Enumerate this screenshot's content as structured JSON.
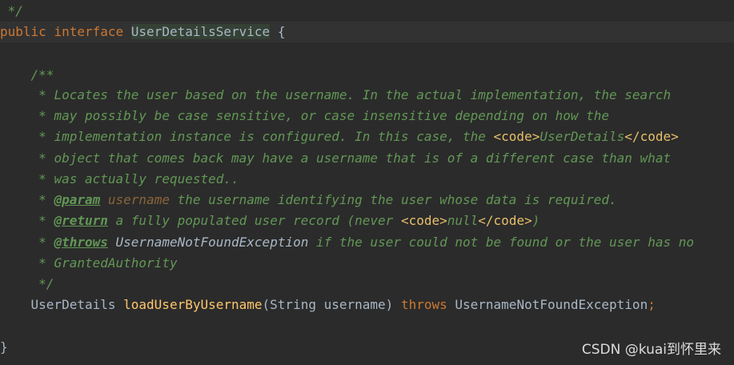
{
  "editor": {
    "lines": {
      "l0": {
        "close": " */"
      },
      "l1": {
        "kw_public": "public",
        "kw_interface": "interface",
        "name": "UserDetailsService",
        "brace": "{"
      },
      "l2": {
        "open": "/**"
      },
      "l3": {
        "text": "Locates the user based on the username. In the actual implementation, the search"
      },
      "l4": {
        "text": "may possibly be case sensitive, or case insensitive depending on how the"
      },
      "l5": {
        "text": "implementation instance is configured. In this case, the ",
        "code_open": "<code>",
        "code_text": "UserDetails",
        "code_close": "</code>"
      },
      "l6": {
        "text": "object that comes back may have a username that is of a different case than what"
      },
      "l7": {
        "text": "was actually requested.."
      },
      "l8": {
        "tag": "@param",
        "param": "username",
        "text": "the username identifying the user whose data is required."
      },
      "l9": {
        "tag": "@return",
        "text": "a fully populated user record (never ",
        "code_open": "<code>",
        "code_text": "null",
        "code_close": "</code>",
        "tail": ")"
      },
      "l10": {
        "tag": "@throws",
        "type": "UsernameNotFoundException",
        "text": "if the user could not be found or the user has no"
      },
      "l11": {
        "text": "GrantedAuthority"
      },
      "l12": {
        "close": "*/"
      },
      "l13": {
        "ret_type": "UserDetails",
        "method": "loadUserByUsername",
        "params": "(String username)",
        "kw_throws": "throws",
        "exception": "UsernameNotFoundException",
        "semi": ";"
      },
      "l14": {
        "brace": "}"
      }
    },
    "doc_star": "*"
  },
  "watermark": "CSDN @kuai到怀里来",
  "colors": {
    "background": "#2b2b2b",
    "current_line": "#323232",
    "keyword": "#cc7832",
    "identifier": "#a9b7c6",
    "method": "#ffc66d",
    "doc_comment": "#629755",
    "doc_param": "#8a653b",
    "doc_html_tag": "#e8bf6a",
    "identifier_highlight": "#344134"
  }
}
